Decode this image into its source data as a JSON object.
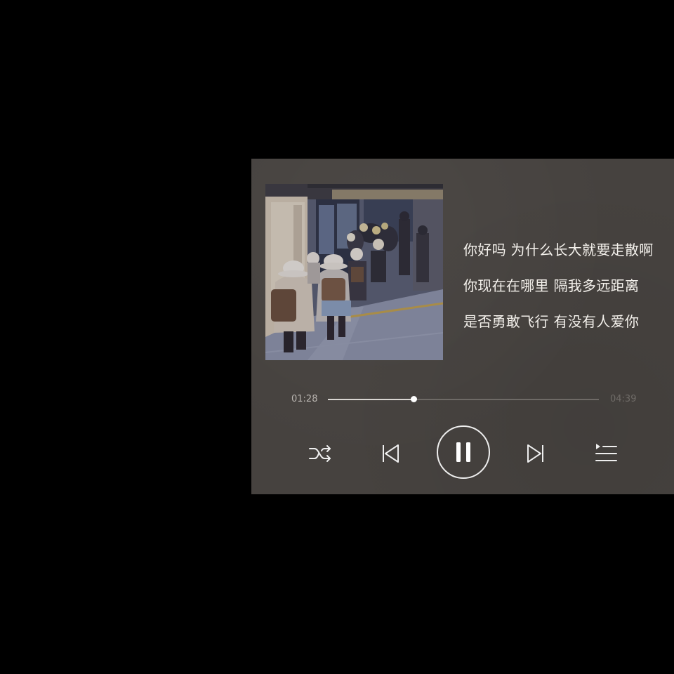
{
  "lyrics": [
    "你好吗 为什么长大就要走散啊",
    "你现在在哪里 隔我多远距离",
    "是否勇敢飞行 有没有人爱你"
  ],
  "playback": {
    "elapsed": "01:28",
    "total": "04:39",
    "progress_fraction": 0.315,
    "state": "playing"
  },
  "controls": {
    "shuffle_icon": "shuffle-icon",
    "previous_icon": "skip-previous-icon",
    "play_pause_icon": "pause-icon",
    "next_icon": "skip-next-icon",
    "playlist_icon": "playlist-icon"
  },
  "colors": {
    "card_background": "#46423f",
    "lyric_text": "#f4f1ec",
    "progress_fill": "#d9d6d2",
    "progress_track": "#6e6a66",
    "icon": "#eeeeee"
  }
}
